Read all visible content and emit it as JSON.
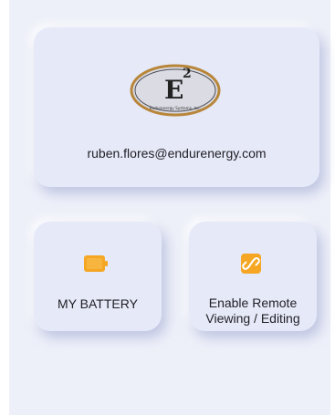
{
  "profile": {
    "logo_text": "E",
    "logo_superscript": "2",
    "logo_tagline": "Endurenergy Systems, Inc.",
    "email": "ruben.flores@endurenergy.com"
  },
  "tiles": [
    {
      "label": "MY BATTERY",
      "icon": "battery-icon"
    },
    {
      "label_line1": "Enable Remote",
      "label_line2": "Viewing / Editing",
      "icon": "link-icon"
    }
  ],
  "colors": {
    "accent": "#f5a623",
    "background": "#eef0f9",
    "card": "#e6e9f8",
    "text": "#1f1f24"
  }
}
